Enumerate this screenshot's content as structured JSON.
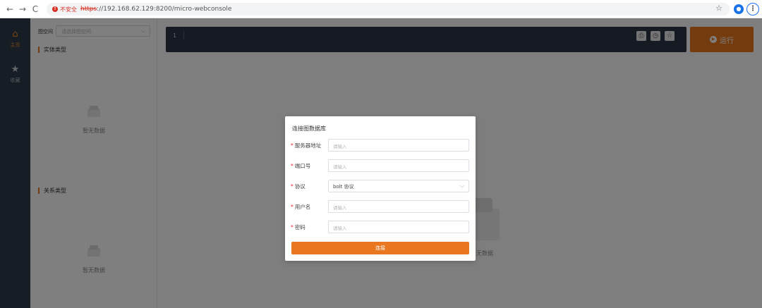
{
  "browser": {
    "back_icon": "←",
    "forward_icon": "→",
    "reload_icon": "C",
    "security_label": "不安全",
    "url_scheme": "https",
    "url_rest": "://192.168.62.129:8200/micro-webconsole",
    "star_icon": "☆",
    "menu_icon": "⋮"
  },
  "sidebar": {
    "items": [
      {
        "label": "主页",
        "icon": "home-icon"
      },
      {
        "label": "收藏",
        "icon": "star-icon"
      }
    ]
  },
  "left_panel": {
    "namespace_label": "图空间",
    "namespace_placeholder": "请选择图空间",
    "entity_section": "实体类型",
    "relation_section": "关系类型",
    "empty_text": "暂无数据"
  },
  "editor": {
    "line_number": "1",
    "run_label": "运行"
  },
  "main": {
    "empty_text": "暂无数据"
  },
  "modal": {
    "title": "连接图数据库",
    "fields": [
      {
        "label": "服务器地址",
        "placeholder": "请输入",
        "type": "input"
      },
      {
        "label": "端口号",
        "placeholder": "请输入",
        "type": "input"
      },
      {
        "label": "协议",
        "value": "bolt 协议",
        "type": "select"
      },
      {
        "label": "用户名",
        "placeholder": "请输入",
        "type": "input"
      },
      {
        "label": "密码",
        "placeholder": "请输入",
        "type": "input"
      }
    ],
    "connect_label": "连接"
  },
  "colors": {
    "accent": "#e8771f",
    "sidebar_bg": "#2f3a4b",
    "editor_bg": "#2d3546",
    "required": "#f5222d"
  }
}
